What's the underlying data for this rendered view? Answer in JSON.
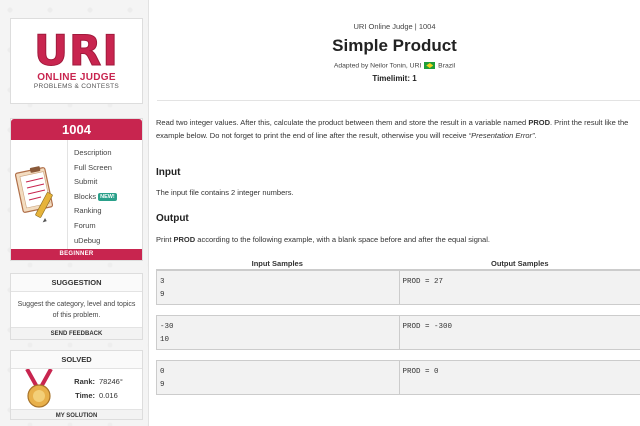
{
  "logo": {
    "big": "URI",
    "line1": "ONLINE JUDGE",
    "line2": "PROBLEMS & CONTESTS"
  },
  "problem_card": {
    "number": "1004",
    "menu": [
      {
        "label": "Description"
      },
      {
        "label": "Full Screen"
      },
      {
        "label": "Submit"
      },
      {
        "label": "Blocks",
        "badge": "NEW!"
      },
      {
        "label": "Ranking"
      },
      {
        "label": "Forum"
      },
      {
        "label": "uDebug"
      }
    ],
    "level": "BEGINNER"
  },
  "suggestion": {
    "title": "SUGGESTION",
    "text": "Suggest the category, level and topics of this problem.",
    "button": "SEND FEEDBACK"
  },
  "solved": {
    "title": "SOLVED",
    "rank_label": "Rank:",
    "rank_value": "78246°",
    "time_label": "Time:",
    "time_value": "0.016",
    "button": "MY SOLUTION"
  },
  "header": {
    "breadcrumb": "URI Online Judge | 1004",
    "title": "Simple Product",
    "adapted_prefix": "Adapted by Neilor Tonin, URI",
    "adapted_country": "Brazil",
    "timelimit": "Timelimit: 1"
  },
  "description": {
    "part1": "Read two integer values. After this, calculate the product between them and store the result in a variable named ",
    "var1": "PROD",
    "part2": ". Print the result like the example below. Do not forget to print the end of line after the result, otherwise you will receive ",
    "error": "“Presentation Error”",
    "part3": "."
  },
  "input_section": {
    "heading": "Input",
    "text": "The input file contains 2 integer numbers."
  },
  "output_section": {
    "heading": "Output",
    "prefix": "Print ",
    "var": "PROD",
    "suffix": " according to the following example, with a blank space before and after the equal signal."
  },
  "samples": {
    "input_header": "Input Samples",
    "output_header": "Output Samples",
    "rows": [
      {
        "input": "3\n9",
        "output": "PROD = 27"
      },
      {
        "input": "-30\n10",
        "output": "PROD = -300"
      },
      {
        "input": "0\n9",
        "output": "PROD = 0"
      }
    ]
  },
  "colors": {
    "brand": "#c8254f",
    "badge": "#2aa08a"
  }
}
